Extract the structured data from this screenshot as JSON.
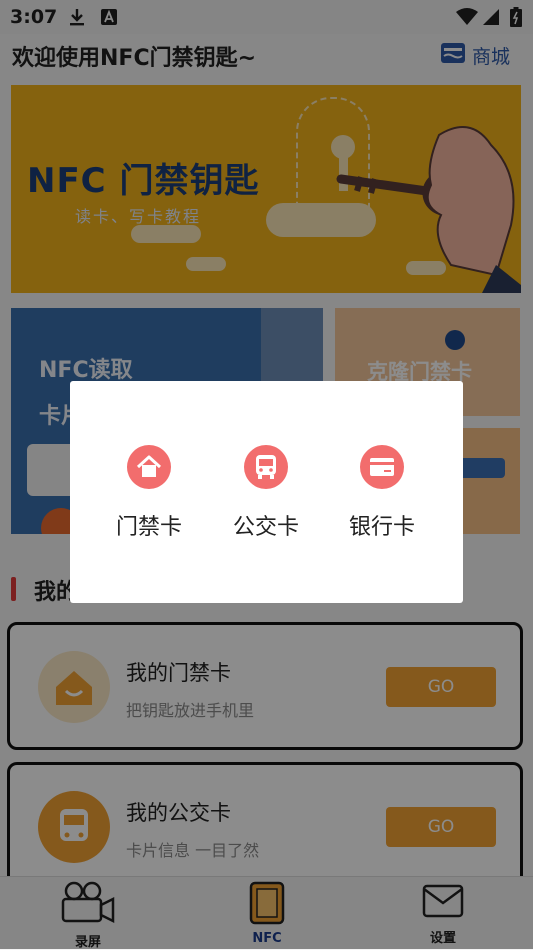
{
  "status_bar": {
    "time": "3:07"
  },
  "header": {
    "title": "欢迎使用NFC门禁钥匙~",
    "mall_label": "商城"
  },
  "banner": {
    "title": "NFC 门禁钥匙",
    "subtitle": "读卡、写卡教程"
  },
  "feature_cards": {
    "nfc_read_line1": "NFC读取",
    "nfc_read_line2": "卡片",
    "clone_label": "克隆门禁卡"
  },
  "section": {
    "title": "我的卡包"
  },
  "cards": [
    {
      "title": "我的门禁卡",
      "subtitle": "把钥匙放进手机里",
      "go_label": "GO"
    },
    {
      "title": "我的公交卡",
      "subtitle": "卡片信息 一目了然",
      "go_label": "GO"
    }
  ],
  "bottom_nav": [
    {
      "label": "录屏",
      "icon": "video-camera-icon"
    },
    {
      "label": "NFC",
      "icon": "phone-nfc-icon"
    },
    {
      "label": "设置",
      "icon": "mail-icon"
    }
  ],
  "dialog": {
    "options": [
      {
        "label": "门禁卡",
        "icon": "home-icon"
      },
      {
        "label": "公交卡",
        "icon": "bus-icon"
      },
      {
        "label": "银行卡",
        "icon": "credit-card-icon"
      }
    ]
  },
  "colors": {
    "accent": "#f26d6d",
    "go_button": "#f3a233",
    "banner": "#f3b21a",
    "card_blue": "#3a6fae"
  }
}
